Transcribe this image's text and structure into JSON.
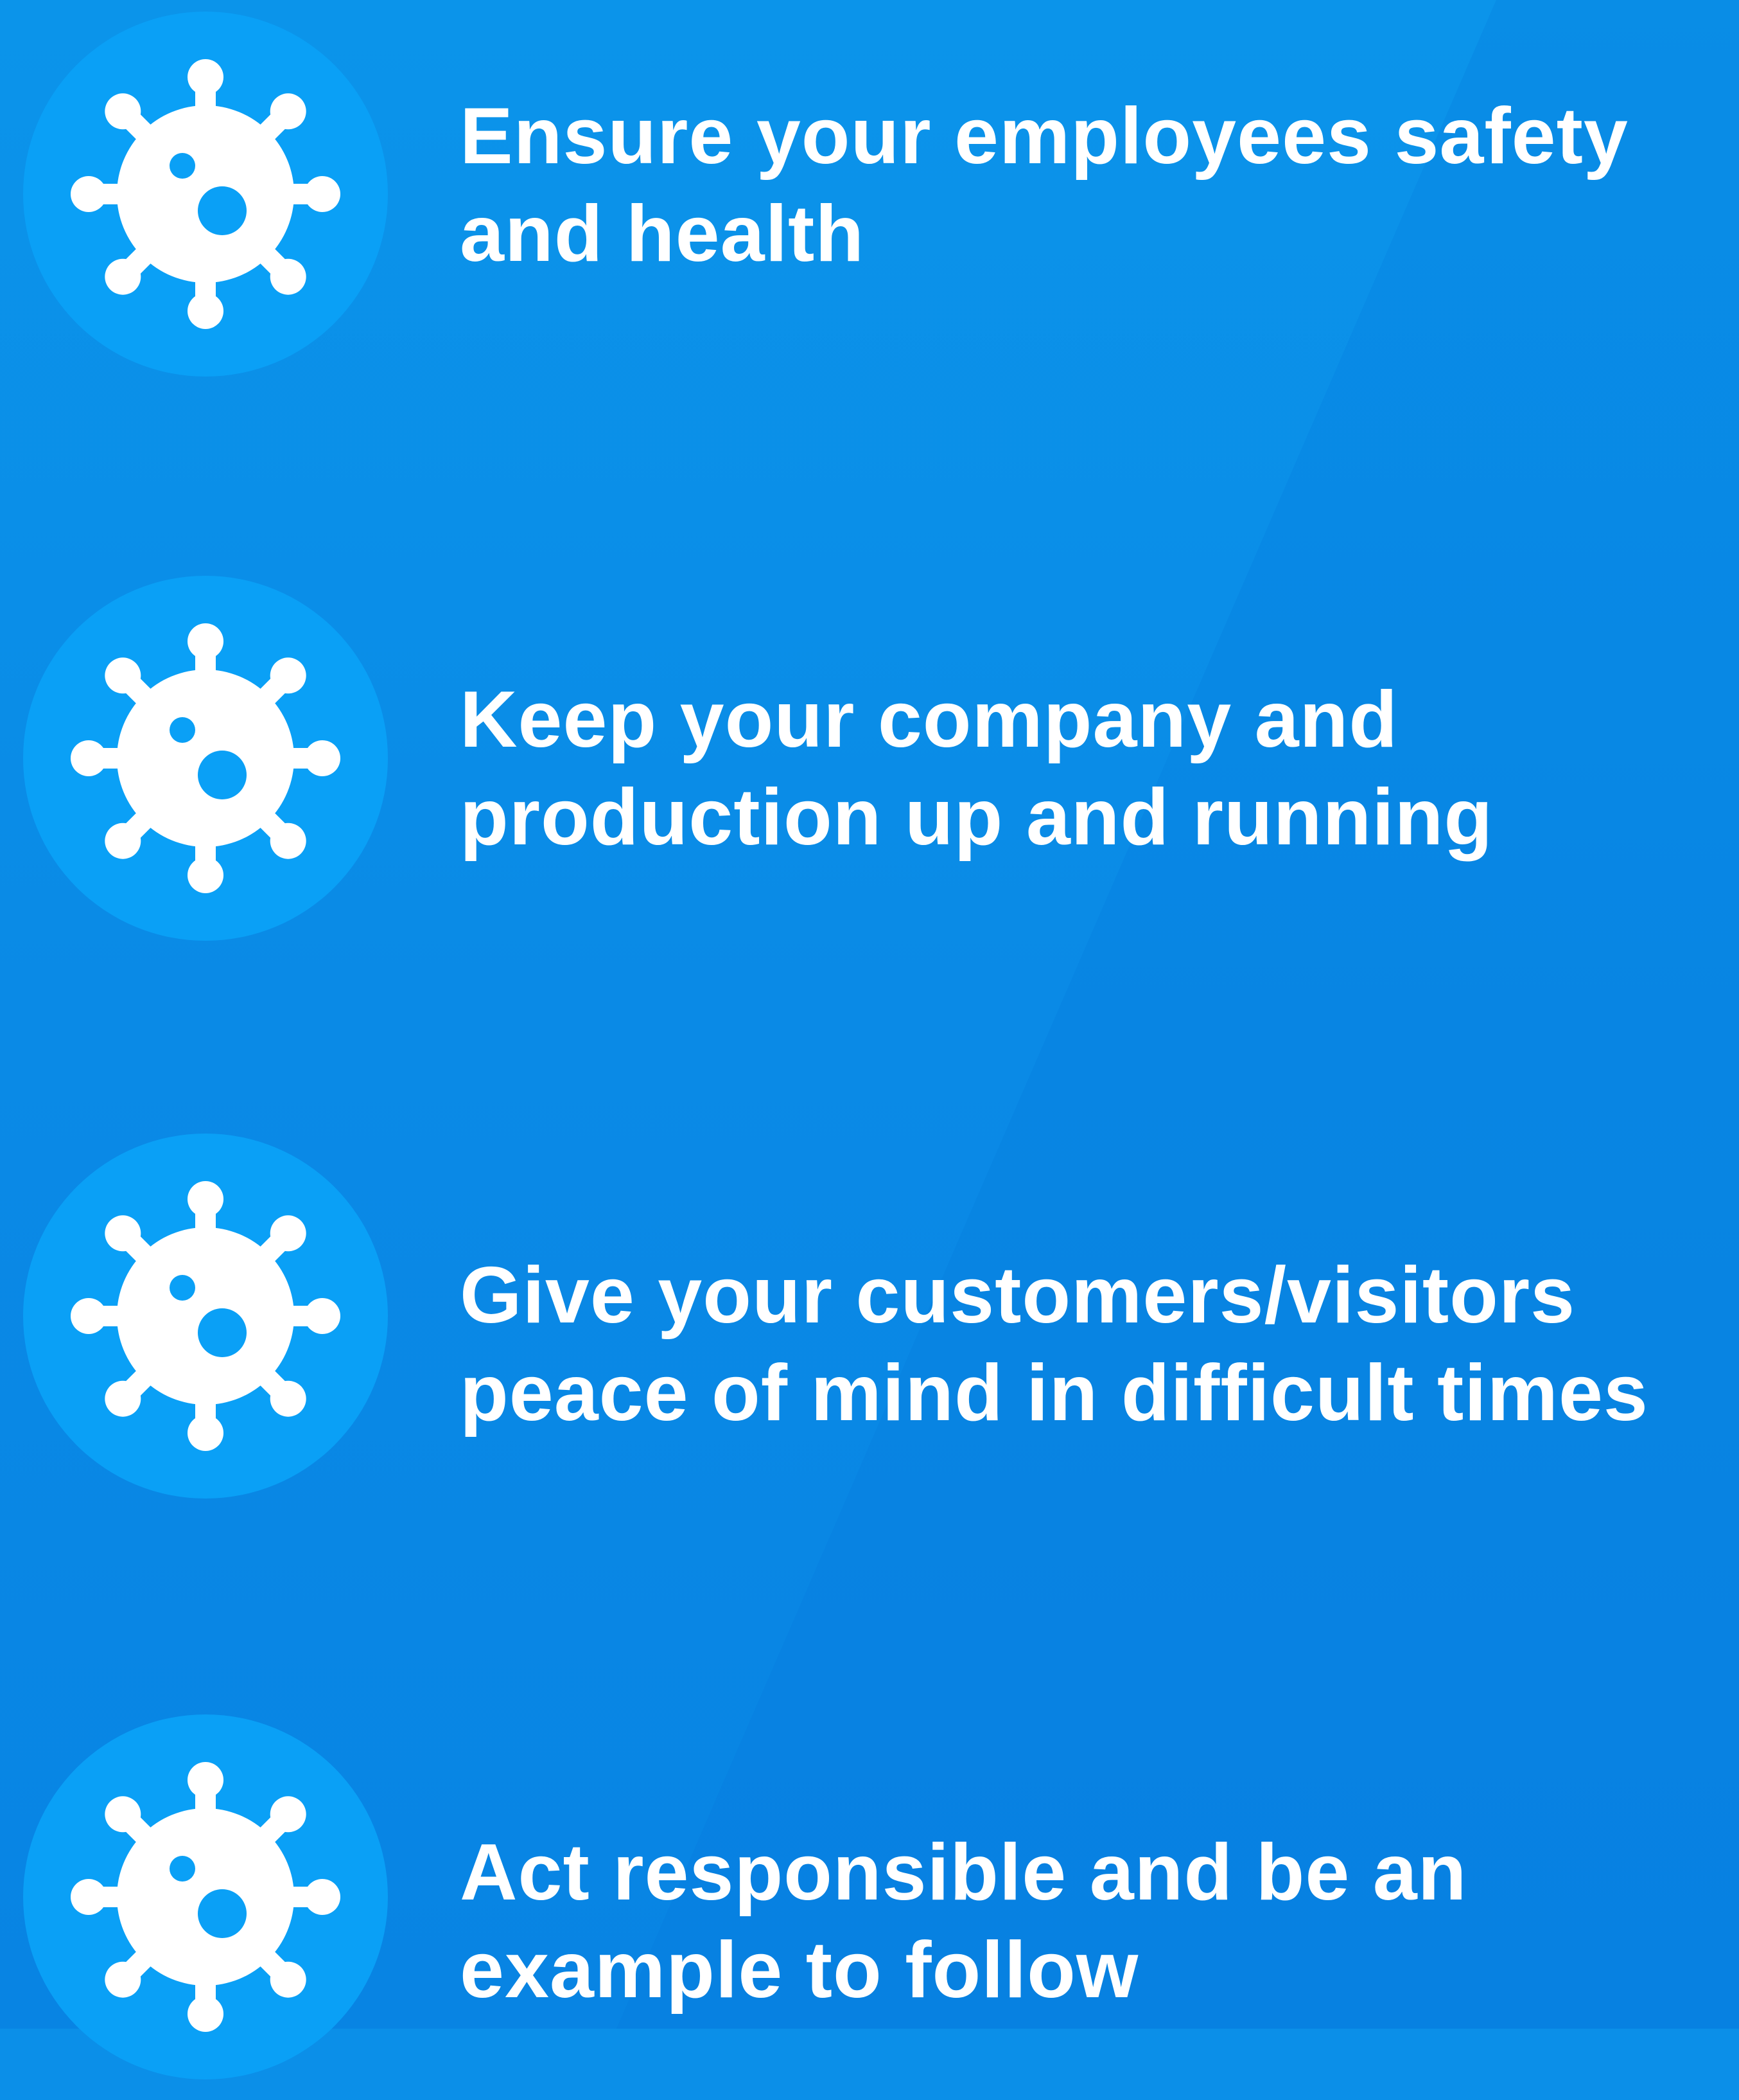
{
  "colors": {
    "background": "#0b8fe8",
    "icon_circle": "#0aa0f6",
    "icon_glyph": "#ffffff",
    "text": "#ffffff"
  },
  "items": [
    {
      "icon": "virus-icon",
      "line1": "Ensure your employees safety",
      "line2": "and health"
    },
    {
      "icon": "virus-icon",
      "line1": "Keep your company and",
      "line2": "production up and running"
    },
    {
      "icon": "virus-icon",
      "line1": "Give your customers/visitors",
      "line2": "peace of mind in difficult times"
    },
    {
      "icon": "virus-icon",
      "line1": "Act responsible and be an",
      "line2": "example to follow"
    }
  ]
}
